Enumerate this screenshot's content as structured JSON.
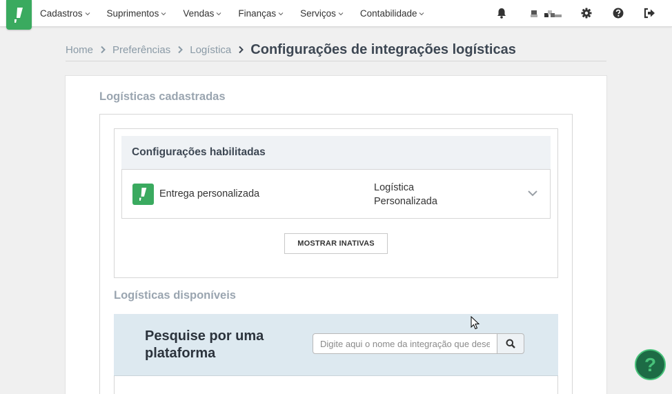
{
  "nav": {
    "logo_icon": "exclamation-logo-icon",
    "menu": [
      {
        "label": "Cadastros"
      },
      {
        "label": "Suprimentos"
      },
      {
        "label": "Vendas"
      },
      {
        "label": "Finanças"
      },
      {
        "label": "Serviços"
      },
      {
        "label": "Contabilidade"
      }
    ],
    "icons": [
      "bell-icon",
      "gear-icon",
      "question-circle-icon",
      "logout-icon"
    ]
  },
  "breadcrumb": {
    "items": [
      "Home",
      "Preferências",
      "Logística"
    ],
    "current": "Configurações de integrações logísticas"
  },
  "registered": {
    "title": "Logísticas cadastradas",
    "enabled_header": "Configurações habilitadas",
    "row": {
      "name": "Entrega personalizada",
      "type_line1": "Logística",
      "type_line2": "Personalizada"
    },
    "show_inactive_label": "MOSTRAR INATIVAS"
  },
  "available": {
    "title": "Logísticas disponíveis",
    "search_title": "Pesquise por uma plataforma",
    "search_placeholder": "Digite aqui o nome da integração que deseja"
  },
  "help": {
    "label": "?"
  },
  "colors": {
    "brand_green": "#3aaa5f",
    "help_bg": "#1d6b45",
    "search_panel": "#dde9f0"
  }
}
